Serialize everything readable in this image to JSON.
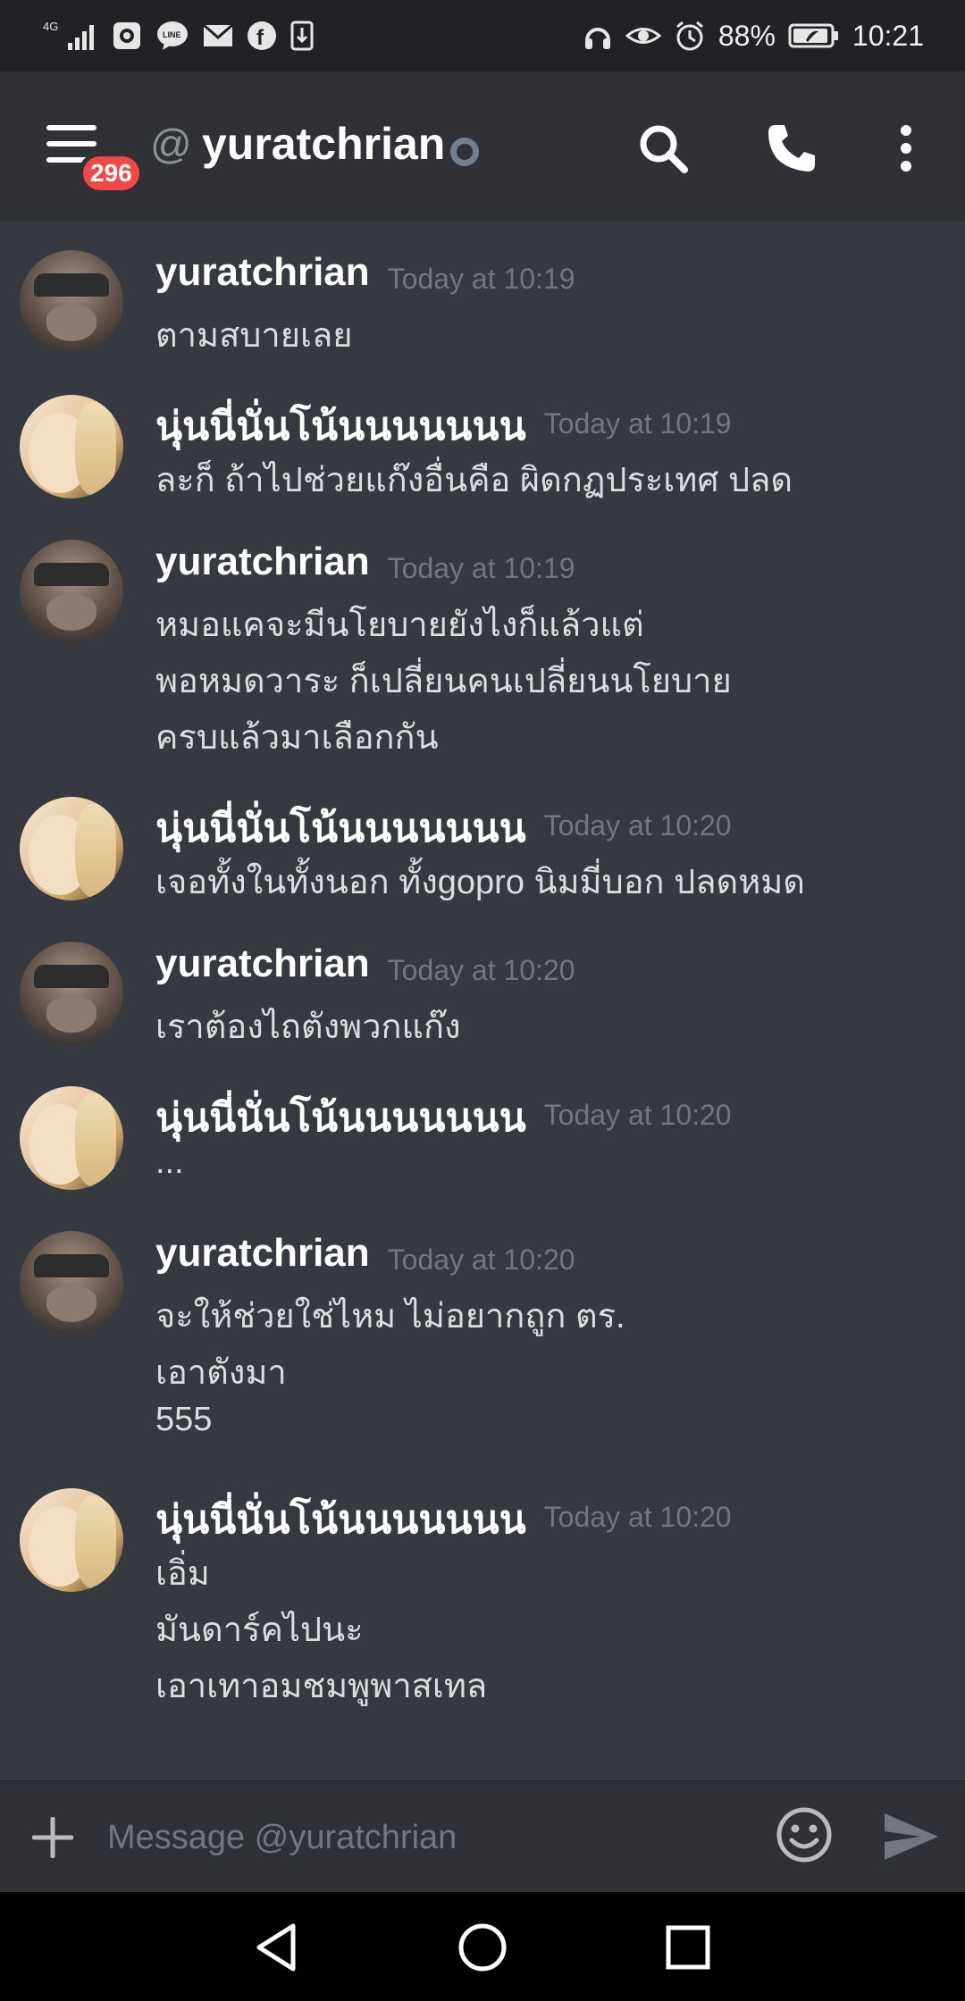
{
  "status_bar": {
    "network": "4G",
    "battery": "88%",
    "time": "10:21",
    "icons": [
      "signal-icon",
      "camera-icon",
      "line-icon",
      "mail-icon",
      "facebook-icon",
      "download-icon",
      "headphones-icon",
      "eye-icon",
      "alarm-icon",
      "battery-icon"
    ]
  },
  "header": {
    "at": "@",
    "channel_name": "yuratchrian",
    "badge_count": "296",
    "icons": [
      "menu-icon",
      "search-icon",
      "phone-icon",
      "more-vertical-icon"
    ]
  },
  "messages": [
    {
      "author": "yuratchrian",
      "timestamp": "Today at 10:19",
      "avatar": "yura",
      "lines": [
        "ตามสบายเลย"
      ]
    },
    {
      "author": "นุ่นนี่นั่นโน้นนนนนนน",
      "timestamp": "Today at 10:19",
      "avatar": "nun",
      "lines": [
        "ละก็ ถ้าไปช่วยแก๊งอื่นคือ ผิดกฏประเทศ ปลด"
      ]
    },
    {
      "author": "yuratchrian",
      "timestamp": "Today at 10:19",
      "avatar": "yura",
      "lines": [
        "หมอแคจะมีนโยบายยังไงก็แล้วแต่",
        "พอหมดวาระ ก็เปลี่ยนคนเปลี่ยนนโยบาย",
        "ครบแล้วมาเลือกกัน"
      ]
    },
    {
      "author": "นุ่นนี่นั่นโน้นนนนนนน",
      "timestamp": "Today at 10:20",
      "avatar": "nun",
      "lines": [
        "เจอทั้งในทั้งนอก ทั้งgopro นิมมี่บอก ปลดหมด"
      ]
    },
    {
      "author": "yuratchrian",
      "timestamp": "Today at 10:20",
      "avatar": "yura",
      "lines": [
        "เราต้องไถตังพวกแก๊ง"
      ]
    },
    {
      "author": "นุ่นนี่นั่นโน้นนนนนนน",
      "timestamp": "Today at 10:20",
      "avatar": "nun",
      "lines": [
        "..."
      ]
    },
    {
      "author": "yuratchrian",
      "timestamp": "Today at 10:20",
      "avatar": "yura",
      "lines": [
        "จะให้ช่วยใช่ไหม ไม่อยากถูก ตร.",
        "เอาตังมา",
        "555"
      ]
    },
    {
      "author": "นุ่นนี่นั่นโน้นนนนนนน",
      "timestamp": "Today at 10:20",
      "avatar": "nun",
      "lines": [
        "เอิ่ม",
        "มันดาร์คไปนะ",
        "เอาเทาอมชมพูพาสเทล"
      ]
    }
  ],
  "composer": {
    "placeholder": "Message @yuratchrian",
    "icons": [
      "plus-icon",
      "emoji-icon",
      "send-icon"
    ]
  },
  "nav_bar": {
    "icons": [
      "back-icon",
      "home-icon",
      "recents-icon"
    ]
  },
  "colors": {
    "background": "#36393f",
    "header": "#2f3136",
    "status_bar": "#202225",
    "badge": "#f04747",
    "timestamp": "#72767d",
    "text": "#dcddde"
  }
}
